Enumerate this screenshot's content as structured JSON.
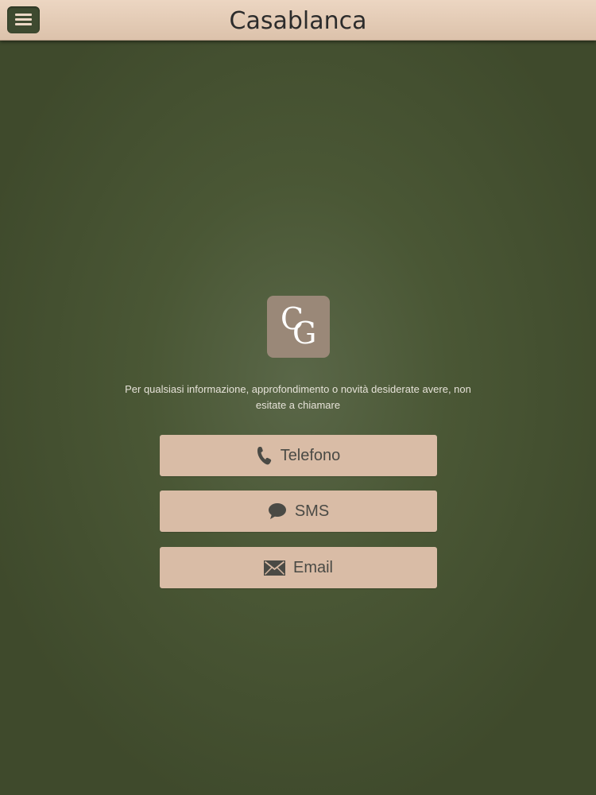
{
  "header": {
    "title": "Casablanca",
    "menu_icon": "hamburger-menu-icon"
  },
  "logo": {
    "letter_1": "C",
    "letter_2": "G"
  },
  "info_text": "Per qualsiasi informazione, approfondimento o novità desiderate avere, non esitate a chiamare",
  "buttons": {
    "telefono": {
      "label": "Telefono",
      "icon": "phone-icon"
    },
    "sms": {
      "label": "SMS",
      "icon": "chat-bubble-icon"
    },
    "email": {
      "label": "Email",
      "icon": "envelope-icon"
    }
  },
  "colors": {
    "background": "#4a5735",
    "header": "#e2c9b3",
    "button": "#d9bca6",
    "logo_bg": "#9a8878"
  }
}
